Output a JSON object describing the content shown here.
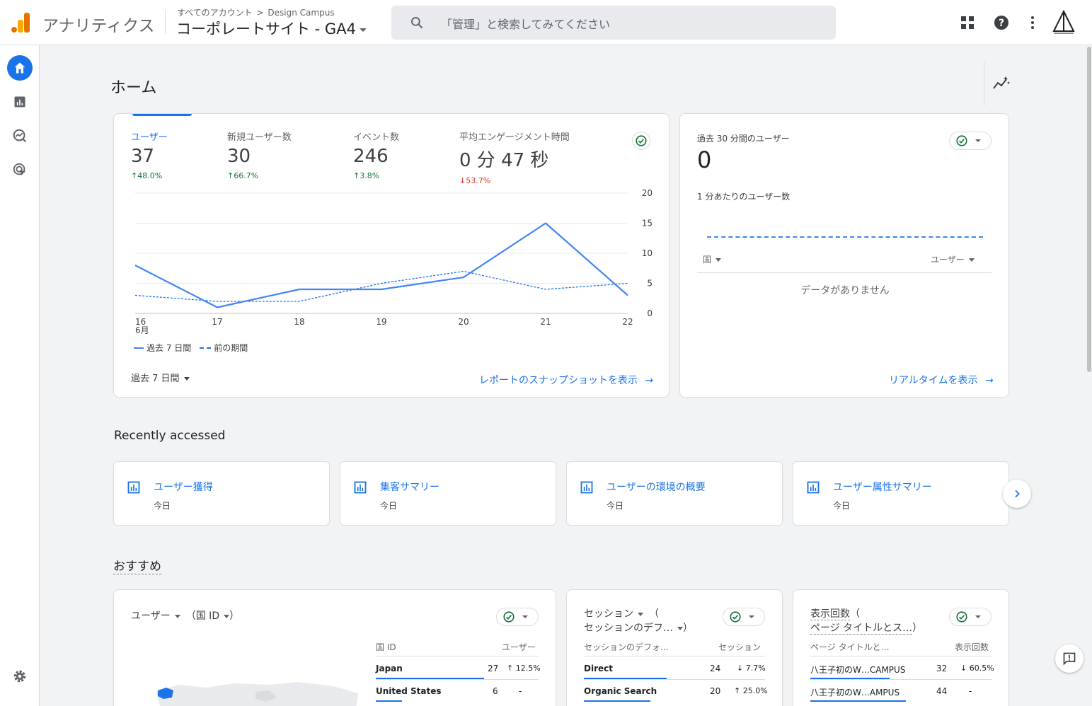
{
  "app": {
    "name": "アナリティクス"
  },
  "breadcrumb": {
    "root": "すべてのアカウント",
    "account": "Design Campus"
  },
  "property": {
    "name": "コーポレートサイト - GA4"
  },
  "search": {
    "placeholder": "「管理」と検索してみてください"
  },
  "topbar_icons": [
    "apps-grid-icon",
    "help-icon",
    "more-vert-icon",
    "account-logo"
  ],
  "sidebar": {
    "items": [
      "home-icon",
      "reports-icon",
      "explore-icon",
      "advertising-icon",
      "settings-icon"
    ]
  },
  "page": {
    "title": "ホーム"
  },
  "overview": {
    "metrics": [
      {
        "label": "ユーザー",
        "value": "37",
        "change": "48.0%",
        "direction": "up"
      },
      {
        "label": "新規ユーザー数",
        "value": "30",
        "change": "66.7%",
        "direction": "up"
      },
      {
        "label": "イベント数",
        "value": "246",
        "change": "3.8%",
        "direction": "up"
      },
      {
        "label": "平均エンゲージメント時間",
        "value": "0 分 47 秒",
        "change": "53.7%",
        "direction": "down"
      }
    ],
    "legend": {
      "current": "過去 7 日間",
      "previous": "前の期間"
    },
    "period_selector": "過去 7 日間",
    "snapshot_link": "レポートのスナップショットを表示"
  },
  "chart_data": {
    "type": "line",
    "x": [
      "16",
      "17",
      "18",
      "19",
      "20",
      "21",
      "22"
    ],
    "x_sublabel": "6月",
    "series": [
      {
        "name": "過去 7 日間",
        "values": [
          8,
          1,
          4,
          4,
          6,
          15,
          3
        ]
      },
      {
        "name": "前の期間",
        "values": [
          3,
          2,
          2,
          5,
          7,
          4,
          5
        ]
      }
    ],
    "yticks": [
      0,
      5,
      10,
      15,
      20
    ],
    "ylim": [
      0,
      20
    ],
    "colors": {
      "current": "#4285f4",
      "previous": "#1a73e8"
    }
  },
  "realtime": {
    "title": "過去 30 分間のユーザー",
    "value": "0",
    "per_minute_label": "1 分あたりのユーザー数",
    "col_country": "国",
    "col_users": "ユーザー",
    "empty": "データがありません",
    "link": "リアルタイムを表示"
  },
  "recent": {
    "title": "Recently accessed",
    "items": [
      {
        "title": "ユーザー獲得",
        "sub": "今日"
      },
      {
        "title": "集客サマリー",
        "sub": "今日"
      },
      {
        "title": "ユーザーの環境の概要",
        "sub": "今日"
      },
      {
        "title": "ユーザー属性サマリー",
        "sub": "今日"
      }
    ]
  },
  "recommended": {
    "title": "おすすめ",
    "cards": [
      {
        "metric": "ユーザー",
        "dimension_prefix": "（",
        "dimension": "国 ID",
        "dimension_suffix": "）",
        "col_dim": "国 ID",
        "col_metric": "ユーザー",
        "rows": [
          {
            "name": "Japan",
            "value": "27",
            "change": "12.5%",
            "direction": "up",
            "share": 0.9
          },
          {
            "name": "United States",
            "value": "6",
            "change": "-",
            "direction": "none",
            "share": 0.22
          }
        ]
      },
      {
        "metric": "セッション",
        "dimension_prefix": "（",
        "dimension": "セッションのデフ…",
        "dimension_suffix": "）",
        "col_dim": "セッションのデフォ…",
        "col_metric": "セッション",
        "rows": [
          {
            "name": "Direct",
            "value": "24",
            "change": "7.7%",
            "direction": "down",
            "share": 0.65
          },
          {
            "name": "Organic Search",
            "value": "20",
            "change": "25.0%",
            "direction": "up",
            "share": 0.52
          }
        ]
      },
      {
        "metric": "表示回数",
        "dimension_prefix": "（",
        "dimension": "ページ タイトルとス…",
        "dimension_suffix": "）",
        "col_dim": "ページ タイトルと…",
        "col_metric": "表示回数",
        "rows": [
          {
            "name": "八王子初のW…CAMPUS",
            "value": "32",
            "change": "60.5%",
            "direction": "down",
            "share": 0.62
          },
          {
            "name": "八王子初のW…AMPUS",
            "value": "44",
            "change": "-",
            "direction": "none",
            "share": 0.75
          }
        ]
      }
    ]
  }
}
